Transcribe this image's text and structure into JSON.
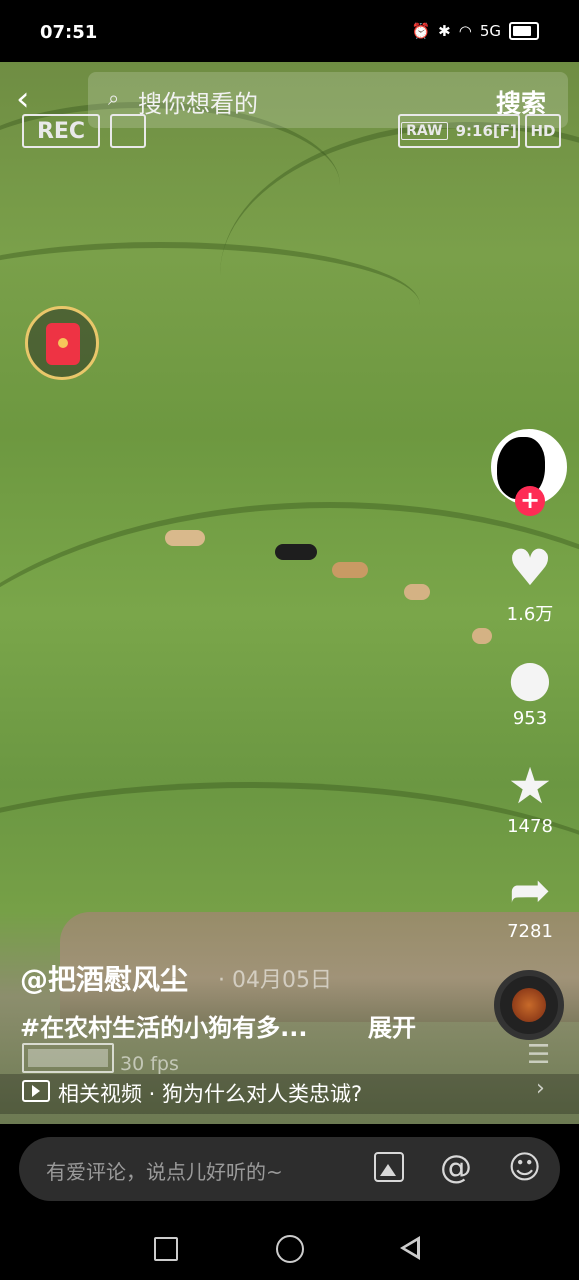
{
  "status_bar": {
    "time": "07:51",
    "icons": [
      "alarm-icon",
      "bluetooth-icon",
      "wifi-icon",
      "signal-5g-icon",
      "battery-icon"
    ],
    "network": "5G"
  },
  "top_bar": {
    "search_placeholder": "搜你想看的",
    "search_button": "搜索"
  },
  "camera_overlay": {
    "rec": "REC",
    "raw": "RAW",
    "ratio": "9:16[F]",
    "hd": "HD",
    "fps": "30 fps"
  },
  "rail": {
    "likes": "1.6万",
    "comments": "953",
    "favorites": "1478",
    "shares": "7281",
    "follow": "+"
  },
  "post": {
    "author": "@把酒慰风尘",
    "date": "· 04月05日",
    "caption": "#在农村生活的小狗有多...",
    "expand": "展开",
    "related": "相关视频 · 狗为什么对人类忠诚?"
  },
  "comment_bar": {
    "placeholder": "有爱评论，说点儿好听的~"
  },
  "colors": {
    "accent": "#fe2c55",
    "red_packet": "#ee3344",
    "ring": "#e9c76a"
  }
}
